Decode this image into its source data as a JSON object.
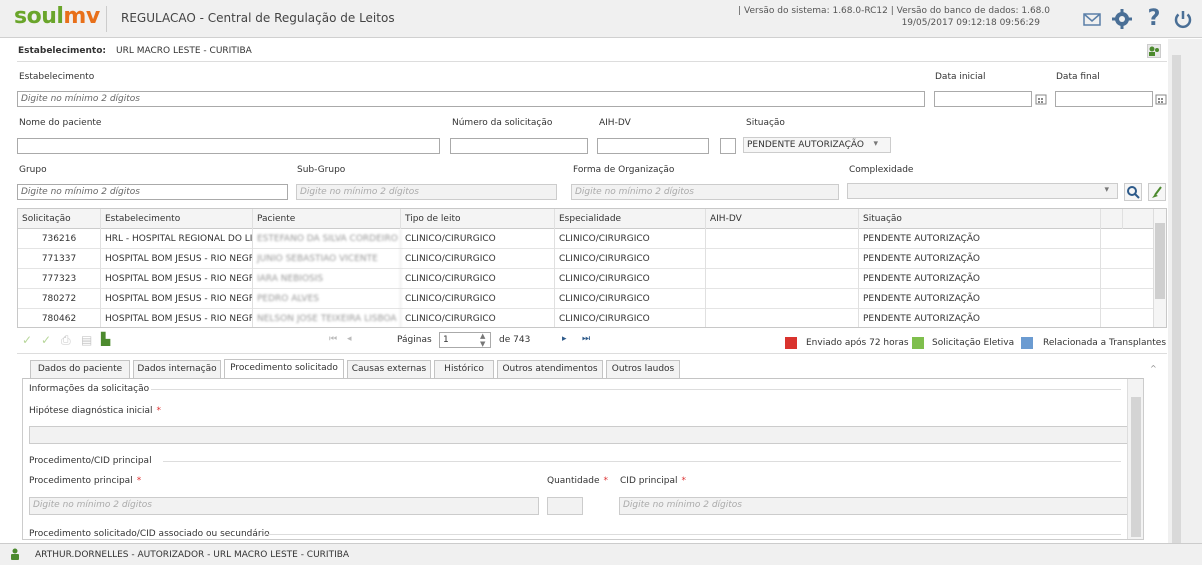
{
  "header": {
    "logo_a": "soul",
    "logo_b": "mv",
    "title": "REGULACAO - Central de Regulação de Leitos",
    "sysinfo_line1": "| Versão do sistema: 1.68.0-RC12 | Versão do banco de dados: 1.68.0",
    "sysinfo_line2": "19/05/2017 09:12:18  09:56:29",
    "icons": [
      "mail-icon",
      "gear-icon",
      "help-icon",
      "power-icon"
    ]
  },
  "estab_bar": {
    "label": "Estabelecimento:",
    "value": "URL MACRO LESTE - CURITIBA"
  },
  "filters": {
    "estabelecimento_label": "Estabelecimento",
    "estabelecimento_placeholder": "Digite no mínimo 2 dígitos",
    "data_inicial_label": "Data inicial",
    "data_final_label": "Data final",
    "nome_label": "Nome do paciente",
    "num_sol_label": "Número da solicitação",
    "aih_label": "AIH-DV",
    "situacao_label": "Situação",
    "situacao_value": "PENDENTE AUTORIZAÇÃO",
    "grupo_label": "Grupo",
    "grupo_placeholder": "Digite no mínimo 2 dígitos",
    "subgrupo_label": "Sub-Grupo",
    "subgrupo_placeholder": "Digite no mínimo 2 dígitos",
    "forma_label": "Forma de Organização",
    "forma_placeholder": "Digite no mínimo 2 dígitos",
    "complexidade_label": "Complexidade"
  },
  "grid": {
    "columns": [
      "Solicitação",
      "Estabelecimento",
      "Paciente",
      "Tipo de leito",
      "Especialidade",
      "AIH-DV",
      "Situação"
    ],
    "rows": [
      [
        "736216",
        "HRL - HOSPITAL REGIONAL DO LI",
        "ESTEFANO DA SILVA CORDEIRO",
        "CLINICO/CIRURGICO",
        "CLINICO/CIRURGICO",
        "",
        "PENDENTE AUTORIZAÇÃO"
      ],
      [
        "771337",
        "HOSPITAL BOM JESUS - RIO NEGF",
        "JUNIO SEBASTIAO VICENTE",
        "CLINICO/CIRURGICO",
        "CLINICO/CIRURGICO",
        "",
        "PENDENTE AUTORIZAÇÃO"
      ],
      [
        "777323",
        "HOSPITAL BOM JESUS - RIO NEGF",
        "IARA NEBIOSIS",
        "CLINICO/CIRURGICO",
        "CLINICO/CIRURGICO",
        "",
        "PENDENTE AUTORIZAÇÃO"
      ],
      [
        "780272",
        "HOSPITAL BOM JESUS - RIO NEGF",
        "PEDRO ALVES",
        "CLINICO/CIRURGICO",
        "CLINICO/CIRURGICO",
        "",
        "PENDENTE AUTORIZAÇÃO"
      ],
      [
        "780462",
        "HOSPITAL BOM JESUS - RIO NEGF",
        "NELSON JOSE TEIXEIRA LISBOA",
        "CLINICO/CIRURGICO",
        "CLINICO/CIRURGICO",
        "",
        "PENDENTE AUTORIZAÇÃO"
      ]
    ]
  },
  "pager": {
    "label": "Páginas",
    "current": "1",
    "total": "de 743"
  },
  "legend": [
    {
      "label": "Enviado após 72 horas",
      "color": "#d9332e"
    },
    {
      "label": "Solicitação Eletiva",
      "color": "#7fbf4d"
    },
    {
      "label": "Relacionada a Transplantes",
      "color": "#6b9bd1"
    }
  ],
  "tabs": [
    "Dados do paciente",
    "Dados internação",
    "Procedimento solicitado",
    "Causas externas",
    "Histórico",
    "Outros atendimentos",
    "Outros laudos"
  ],
  "panel": {
    "sec_info": "Informações da solicitação",
    "hipotese_label": "Hipótese diagnóstica inicial",
    "sec_proc": "Procedimento/CID principal",
    "proc_label": "Procedimento principal",
    "proc_placeholder": "Digite no mínimo 2 dígitos",
    "qtd_label": "Quantidade",
    "cid_label": "CID principal",
    "cid_placeholder": "Digite no mínimo 2 dígitos",
    "sec_sec": "Procedimento solicitado/CID associado ou secundário"
  },
  "status": {
    "user": "ARTHUR.DORNELLES - AUTORIZADOR - URL MACRO LESTE - CURITIBA"
  }
}
